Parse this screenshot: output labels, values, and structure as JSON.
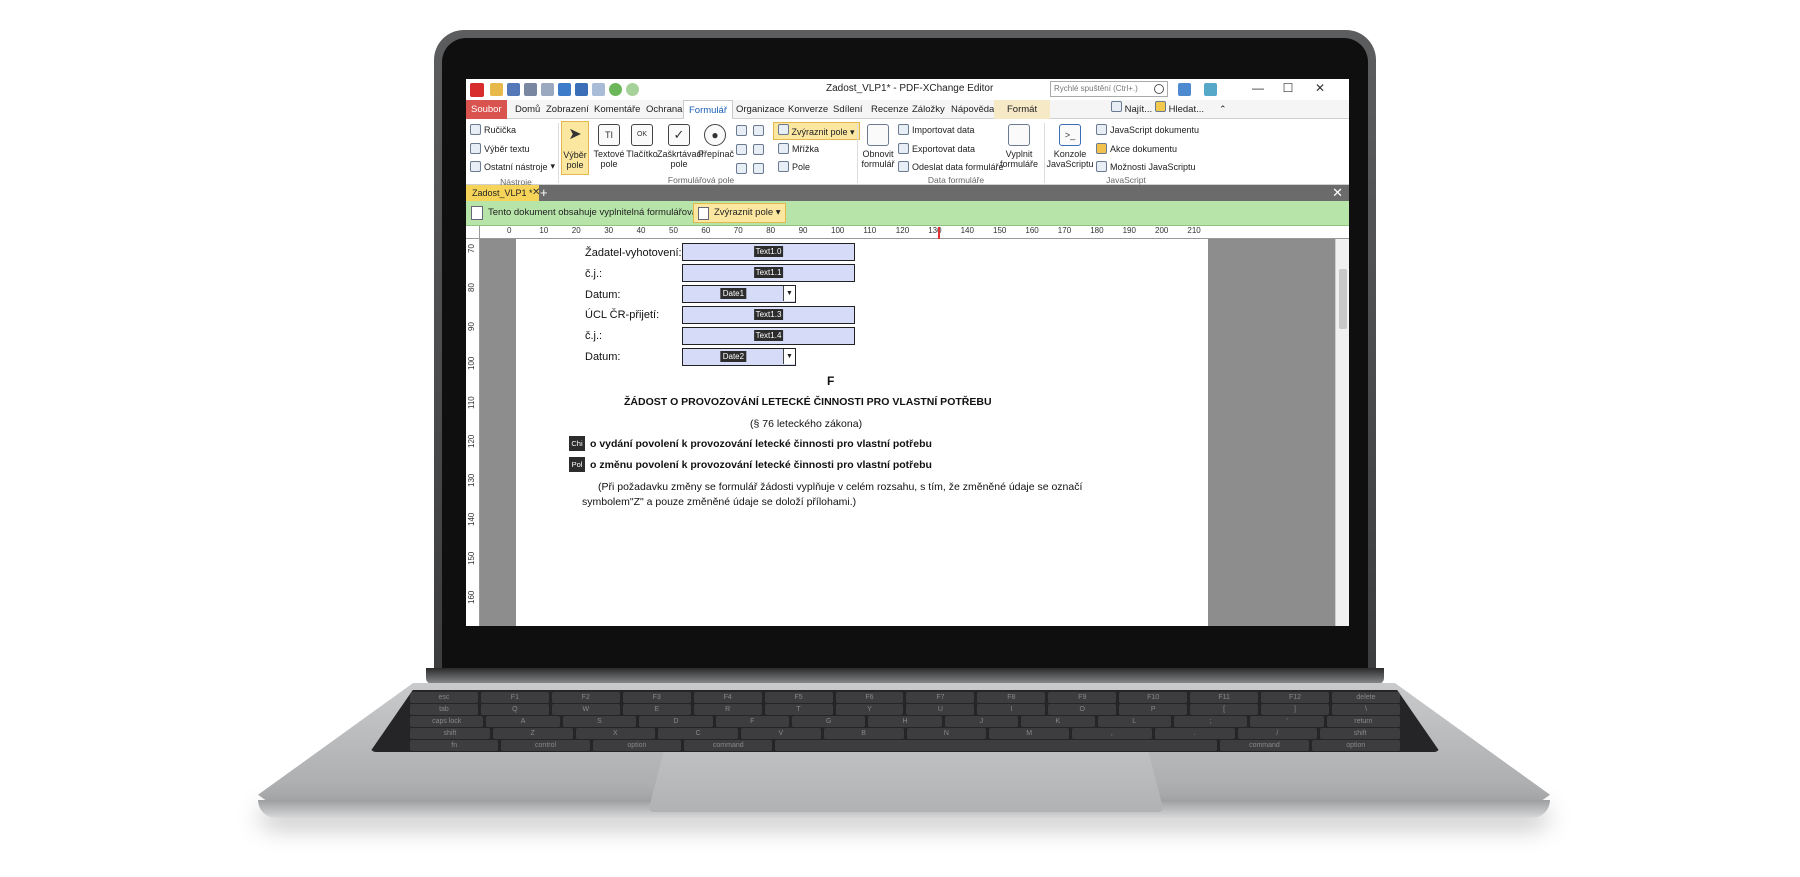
{
  "window": {
    "title": "Zadost_VLP1* - PDF-XChange Editor",
    "quick_search_placeholder": "Rychlé spuštění (Ctrl+.)",
    "minimize": "—",
    "maximize": "☐",
    "close": "✕"
  },
  "tabs": [
    {
      "label": "Soubor"
    },
    {
      "label": "Domů"
    },
    {
      "label": "Zobrazení"
    },
    {
      "label": "Komentáře"
    },
    {
      "label": "Ochrana"
    },
    {
      "label": "Formulář"
    },
    {
      "label": "Organizace"
    },
    {
      "label": "Konverze"
    },
    {
      "label": "Sdílení"
    },
    {
      "label": "Recenze"
    },
    {
      "label": "Záložky"
    },
    {
      "label": "Nápověda"
    },
    {
      "label": "Formát"
    }
  ],
  "tabs_right": {
    "find": "Najít...",
    "search": "Hledat..."
  },
  "ribbon": {
    "tools": {
      "hand": "Ručička",
      "select_text": "Výběr textu",
      "other_tools": "Ostatní nástroje",
      "group": "Nástroje"
    },
    "form_fields": {
      "select_field_1": "Výběr",
      "select_field_2": "pole",
      "text_field_1": "Textové",
      "text_field_2": "pole",
      "button": "Tlačítko",
      "checkbox_1": "Zaškrtávací",
      "checkbox_2": "pole",
      "radio": "Přepínač",
      "highlight": "Zvýraznit pole",
      "grid": "Mřížka",
      "field": "Pole",
      "group": "Formulářová pole"
    },
    "form_data": {
      "reset_1": "Obnovit",
      "reset_2": "formulář",
      "import": "Importovat data",
      "export": "Exportovat data",
      "submit": "Odeslat data formuláře",
      "fill_1": "Vyplnit",
      "fill_2": "formuláře",
      "group": "Data formuláře"
    },
    "javascript": {
      "console_1": "Konzole",
      "console_2": "JavaScriptu",
      "doc_js": "JavaScript dokumentu",
      "doc_actions": "Akce dokumentu",
      "js_options": "Možnosti JavaScriptu",
      "group": "JavaScript"
    }
  },
  "document_tab": {
    "label": "Zadost_VLP1 *",
    "close": "✕",
    "add": "+"
  },
  "notice": {
    "text": "Tento dokument obsahuje vyplnitelná formulářová pole.",
    "button": "Zvýraznit pole"
  },
  "ruler_h": [
    "0",
    "10",
    "20",
    "30",
    "40",
    "50",
    "60",
    "70",
    "80",
    "90",
    "100",
    "110",
    "120",
    "130",
    "140",
    "150",
    "160",
    "170",
    "180",
    "190",
    "200",
    "210"
  ],
  "ruler_v": [
    "70",
    "80",
    "90",
    "100",
    "110",
    "120",
    "130",
    "140",
    "150",
    "160"
  ],
  "form": {
    "rows": [
      {
        "label": "Žadatel-vyhotovení:",
        "field": "Text1.0"
      },
      {
        "label": "č.j.:",
        "field": "Text1.1"
      },
      {
        "label": "Datum:",
        "field": "Date1"
      },
      {
        "label": "ÚCL ČR-přijetí:",
        "field": "Text1.3"
      },
      {
        "label": "č.j.:",
        "field": "Text1.4"
      },
      {
        "label": "Datum:",
        "field": "Date2"
      }
    ],
    "letter": "F",
    "heading": "ŽÁDOST  O  PROVOZOVÁNÍ  LETECKÉ  ČINNOSTI  PRO VLASTNÍ  POTŘEBU",
    "subheading": "(§  76  leteckého  zákona)",
    "option1_tag": "Chi",
    "option1": "o vydání povolení k provozování letecké činnosti pro vlastní potřebu",
    "option2_tag": "Pol",
    "option2": "o změnu povolení k provozování letecké činnosti pro vlastní potřebu",
    "note_line1": "(Při požadavku  změny se formulář žádosti  vyplňuje v celém rozsahu, s  tím, že změněné  údaje se označí",
    "note_line2": "symbolem\"Z\" a pouze změněné údaje se doloží přílohami.)"
  },
  "keyboard": {
    "row1": [
      "esc",
      "F1",
      "F2",
      "F3",
      "F4",
      "F5",
      "F6",
      "F7",
      "F8",
      "F9",
      "F10",
      "F11",
      "F12",
      "delete"
    ],
    "row2": [
      "tab",
      "Q",
      "W",
      "E",
      "R",
      "T",
      "Y",
      "U",
      "I",
      "O",
      "P",
      "[",
      "]",
      "\\"
    ],
    "row3": [
      "caps lock",
      "A",
      "S",
      "D",
      "F",
      "G",
      "H",
      "J",
      "K",
      "L",
      ";",
      "'",
      "return"
    ],
    "row4": [
      "shift",
      "Z",
      "X",
      "C",
      "V",
      "B",
      "N",
      "M",
      ",",
      ".",
      "/",
      "shift"
    ],
    "row5": [
      "fn",
      "control",
      "option",
      "command",
      "",
      "command",
      "option"
    ]
  }
}
